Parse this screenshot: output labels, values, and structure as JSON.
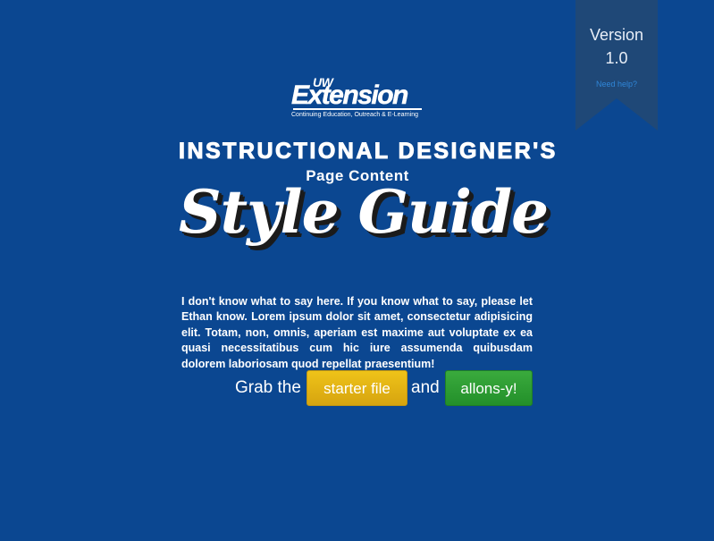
{
  "ribbon": {
    "version_label": "Version",
    "version_number": "1.0",
    "help_link": "Need help?"
  },
  "logo": {
    "uw": "UW",
    "name": "Extension",
    "tagline": "Continuing Education, Outreach & E-Learning"
  },
  "header": {
    "title": "INSTRUCTIONAL DESIGNER'S",
    "subtitle": "Page Content",
    "script_title": "Style Guide"
  },
  "intro": {
    "text": "I don't know what to say here. If you know what to say, please let Ethan know. Lorem ipsum dolor sit amet, consectetur adipisicing elit. Totam, non, omnis, aperiam est maxime aut voluptate ex ea quasi necessitatibus cum hic iure assumenda quibusdam dolorem laboriosam quod repellat praesentium!"
  },
  "cta": {
    "grab_text": "Grab the",
    "starter_button": "starter file",
    "and_text": "and",
    "go_button": "allons-y!"
  },
  "colors": {
    "background": "#0b4791",
    "ribbon": "#1f4877",
    "starter_button": "#e2b214",
    "go_button": "#2e9e33",
    "help_link": "#2f86d8"
  }
}
